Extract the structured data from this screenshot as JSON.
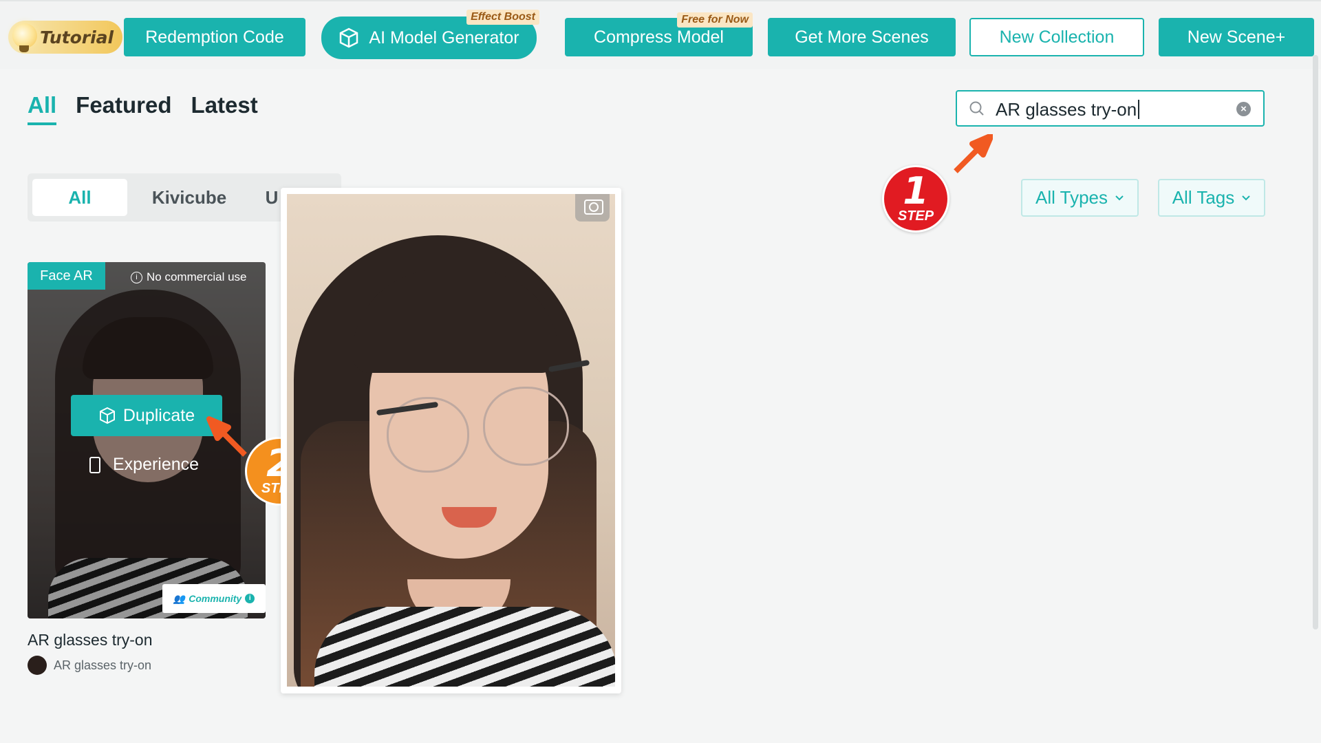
{
  "toolbar": {
    "tutorial": "Tutorial",
    "redemption": "Redemption Code",
    "ai_model": "AI Model Generator",
    "ai_model_badge": "Effect Boost",
    "compress": "Compress Model",
    "compress_badge": "Free for Now",
    "get_scenes": "Get More Scenes",
    "new_collection": "New Collection",
    "new_scene": "New Scene+"
  },
  "tabs": [
    "All",
    "Featured",
    "Latest"
  ],
  "search": {
    "value": "AR glasses try-on"
  },
  "filters": {
    "types": "All Types",
    "tags": "All Tags"
  },
  "segment": [
    "All",
    "Kivicube",
    "U"
  ],
  "card": {
    "type_tag": "Face AR",
    "commercial": "No commercial use",
    "duplicate": "Duplicate",
    "experience": "Experience",
    "community": "Community",
    "title": "AR glasses try-on",
    "author": "AR glasses try-on"
  },
  "steps": {
    "one": {
      "num": "1",
      "label": "STEP"
    },
    "two": {
      "num": "2",
      "label": "STEP"
    }
  },
  "colors": {
    "accent": "#1ab3ae",
    "step1": "#e11b22",
    "step2": "#f4901e",
    "arrow": "#f15a22"
  }
}
